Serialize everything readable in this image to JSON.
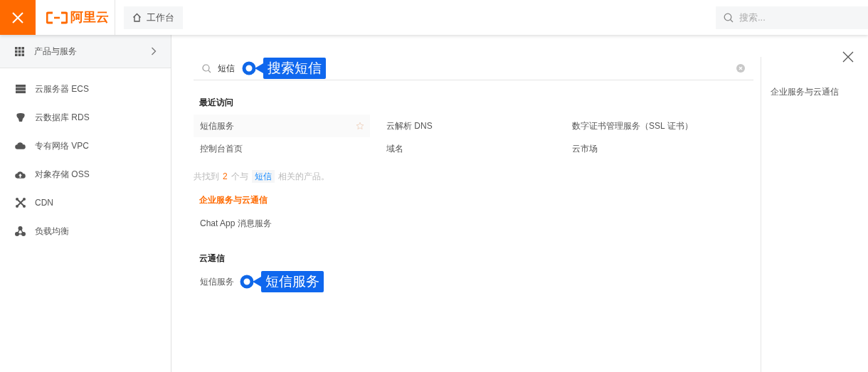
{
  "header": {
    "logo": "阿里云",
    "workbench_tab": "工作台",
    "search": {
      "placeholder": "搜索..."
    }
  },
  "sidebar": {
    "products_entry": "产品与服务",
    "items": [
      {
        "label": "云服务器 ECS",
        "kind": "server"
      },
      {
        "label": "云数据库 RDS",
        "kind": "database"
      },
      {
        "label": "专有网络 VPC",
        "kind": "cloud"
      },
      {
        "label": "对象存储 OSS",
        "kind": "storage"
      },
      {
        "label": "CDN",
        "kind": "cdn"
      },
      {
        "label": "负载均衡",
        "kind": "balance"
      }
    ]
  },
  "search": {
    "value": "短信"
  },
  "recent": {
    "title": "最近访问",
    "items": [
      {
        "label": "短信服务",
        "hovered": true
      },
      {
        "label": "云解析 DNS",
        "hovered": false
      },
      {
        "label": "数字证书管理服务（SSL 证书）",
        "hovered": false
      },
      {
        "label": "控制台首页",
        "hovered": false
      },
      {
        "label": "域名",
        "hovered": false
      },
      {
        "label": "云市场",
        "hovered": false
      }
    ]
  },
  "result_summary": {
    "prefix": "共找到",
    "count": "2",
    "middle": "个与",
    "keyword": "短信",
    "suffix": "相关的产品。"
  },
  "groups": [
    {
      "title": "企业服务与云通信",
      "selected": true,
      "items": [
        {
          "label": "Chat App 消息服务"
        }
      ]
    },
    {
      "title": "云通信",
      "selected": false,
      "items": [
        {
          "label": "短信服务",
          "annotation": "短信服务"
        }
      ]
    }
  ],
  "search_annotation": "搜索短信",
  "category_panel": {
    "items": [
      {
        "label": "企业服务与云通信"
      }
    ]
  }
}
